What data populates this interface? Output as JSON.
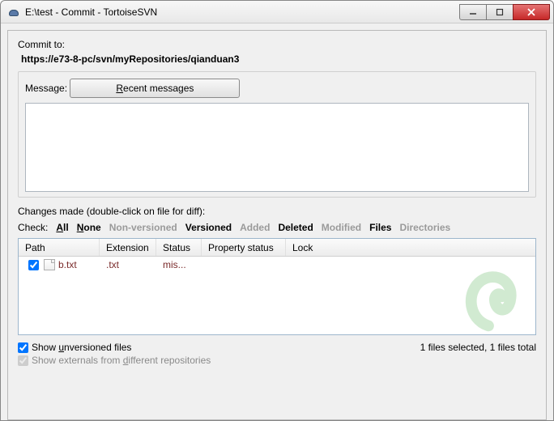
{
  "window": {
    "title": "E:\\test - Commit - TortoiseSVN"
  },
  "commit": {
    "label": "Commit to:",
    "url": "https://e73-8-pc/svn/myRepositories/qianduan3"
  },
  "message": {
    "legend": "Message:",
    "recent_btn_pre": "R",
    "recent_btn_rest": "ecent messages"
  },
  "changes": {
    "label": "Changes made (double-click on file for diff):",
    "check_label": "Check:",
    "filters": {
      "all_u": "A",
      "all_rest": "ll",
      "none_u": "N",
      "none_rest": "one",
      "nonversioned": "Non-versioned",
      "versioned": "Versioned",
      "added": "Added",
      "deleted": "Deleted",
      "modified": "Modified",
      "files": "Files",
      "directories": "Directories"
    },
    "columns": {
      "path": "Path",
      "extension": "Extension",
      "status": "Status",
      "property_status": "Property status",
      "lock": "Lock"
    },
    "rows": [
      {
        "path": "b.txt",
        "extension": ".txt",
        "status": "mis...",
        "property_status": "",
        "lock": ""
      }
    ],
    "status_text": "1 files selected, 1 files total"
  },
  "options": {
    "show_unversioned_pre": "Show ",
    "show_unversioned_u": "u",
    "show_unversioned_rest": "nversioned files",
    "show_externals_pre": "Show externals from ",
    "show_externals_u": "d",
    "show_externals_rest": "ifferent repositories"
  }
}
